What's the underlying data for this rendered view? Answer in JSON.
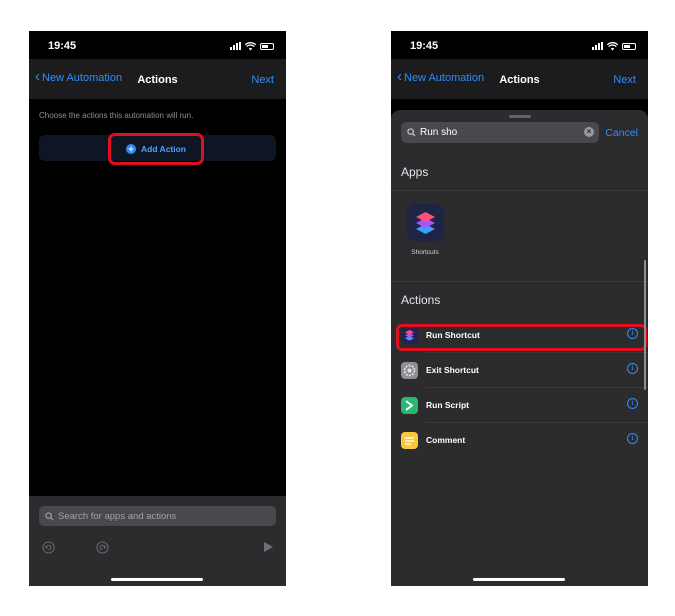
{
  "left": {
    "status_time": "19:45",
    "nav": {
      "back_label": "New Automation",
      "title": "Actions",
      "next_label": "Next"
    },
    "prompt": "Choose the actions this automation will run.",
    "add_action_label": "Add Action",
    "search_placeholder": "Search for apps and actions"
  },
  "right": {
    "status_time": "19:45",
    "nav": {
      "back_label": "New Automation",
      "title": "Actions",
      "next_label": "Next"
    },
    "search": {
      "value": "Run sho",
      "cancel_label": "Cancel"
    },
    "apps_section": {
      "title": "Apps",
      "items": [
        {
          "label": "Shortcuts",
          "icon": "shortcuts-app-icon"
        }
      ]
    },
    "actions_section": {
      "title": "Actions",
      "items": [
        {
          "label": "Run Shortcut",
          "icon": "shortcuts-icon",
          "color": "#8a49e6"
        },
        {
          "label": "Exit Shortcut",
          "icon": "gear-icon",
          "color": "#8e8e93"
        },
        {
          "label": "Run Script",
          "icon": "script-icon",
          "color": "#2bb673"
        },
        {
          "label": "Comment",
          "icon": "comment-icon",
          "color": "#f7c83c"
        }
      ]
    }
  },
  "colors": {
    "accent": "#2f8dfb",
    "highlight": "#e0101e",
    "background": "#000000",
    "panel": "#2c2c2e"
  }
}
